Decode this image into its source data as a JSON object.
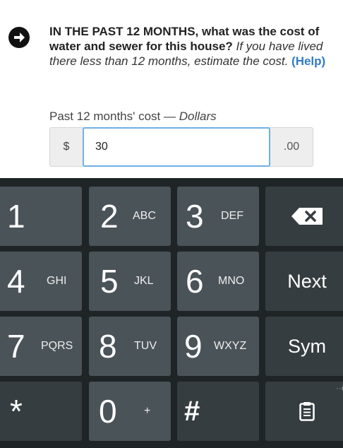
{
  "question": {
    "bold_text": "IN THE PAST 12 MONTHS, what was the cost of water and sewer for this house?",
    "italic_text": "If you have lived there less than 12 months, estimate the cost.",
    "help_link": "(Help)"
  },
  "field": {
    "label_main": "Past 12 months' cost — ",
    "label_unit": "Dollars",
    "prefix": "$",
    "value": "30",
    "suffix": ".00"
  },
  "keyboard": {
    "keys": {
      "k1": {
        "digit": "1"
      },
      "k2": {
        "digit": "2",
        "letters": "ABC"
      },
      "k3": {
        "digit": "3",
        "letters": "DEF"
      },
      "k4": {
        "digit": "4",
        "letters": "GHI"
      },
      "k5": {
        "digit": "5",
        "letters": "JKL"
      },
      "k6": {
        "digit": "6",
        "letters": "MNO"
      },
      "k7": {
        "digit": "7",
        "letters": "PQRS"
      },
      "k8": {
        "digit": "8",
        "letters": "TUV"
      },
      "k9": {
        "digit": "9",
        "letters": "WXYZ"
      },
      "k0": {
        "digit": "0",
        "letters": "+"
      },
      "star": {
        "label": "*"
      },
      "hash": {
        "label": "#"
      },
      "next": {
        "label": "Next"
      },
      "sym": {
        "label": "Sym"
      }
    },
    "backspace_icon": "backspace-icon",
    "clipboard_icon": "clipboard-icon",
    "more_indicator": "··c"
  },
  "colors": {
    "help_link": "#2f7bc4",
    "input_focus_border": "#6fb0e6",
    "keyboard_bg": "#1f2426",
    "key_bg": "#4a5358",
    "key_dark_bg": "#363d41"
  }
}
